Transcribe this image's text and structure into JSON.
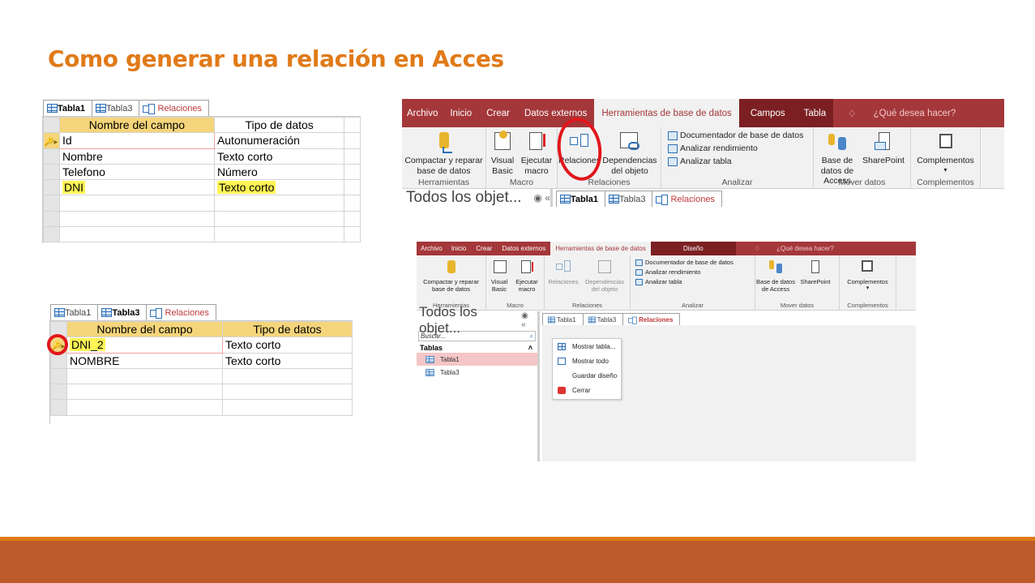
{
  "slide": {
    "title": "Como generar una relación en Acces",
    "accent_color": "#E07A18",
    "footer_color": "#BE5B2A"
  },
  "panel1": {
    "tabs": [
      {
        "label": "Tabla1",
        "icon": "table-icon",
        "active": true
      },
      {
        "label": "Tabla3",
        "icon": "table-icon",
        "active": false
      },
      {
        "label": "Relaciones",
        "icon": "relationships-icon",
        "active": false
      }
    ],
    "headers": [
      "Nombre del campo",
      "Tipo de datos"
    ],
    "rows": [
      {
        "field": "Id",
        "type": "Autonumeración",
        "key": true,
        "highlight": false
      },
      {
        "field": "Nombre",
        "type": "Texto corto",
        "key": false,
        "highlight": false
      },
      {
        "field": "Telefono",
        "type": "Número",
        "key": false,
        "highlight": false
      },
      {
        "field": "DNI",
        "type": "Texto corto",
        "key": false,
        "highlight": true
      }
    ]
  },
  "panel2": {
    "tabs": [
      {
        "label": "Tabla1",
        "icon": "table-icon",
        "active": false
      },
      {
        "label": "Tabla3",
        "icon": "table-icon",
        "active": true
      },
      {
        "label": "Relaciones",
        "icon": "relationships-icon",
        "active": false
      }
    ],
    "headers": [
      "Nombre del campo",
      "Tipo de datos"
    ],
    "rows": [
      {
        "field": "DNI_2",
        "type": "Texto corto",
        "key": true
      },
      {
        "field": "NOMBRE",
        "type": "Texto corto",
        "key": false
      }
    ]
  },
  "ribbon1": {
    "tabs": [
      "Archivo",
      "Inicio",
      "Crear",
      "Datos externos",
      "Herramientas de base de datos",
      "Campos",
      "Tabla"
    ],
    "tell_me": "¿Qué desea hacer?",
    "buttons": {
      "compact": "Compactar y reparar base de datos",
      "visual_basic": "Visual Basic",
      "run_macro": "Ejecutar macro",
      "relations": "Relaciones",
      "dependencies": "Dependencias del objeto",
      "documenter": "Documentador de base de datos",
      "analyze_perf": "Analizar rendimiento",
      "analyze_table": "Analizar tabla",
      "access_db": "Base de datos de Access",
      "sharepoint": "SharePoint",
      "addins": "Complementos"
    },
    "groups": [
      "Herramientas",
      "Macro",
      "Relaciones",
      "Analizar",
      "Mover datos",
      "Complementos"
    ],
    "nav_title": "Todos los objet...",
    "doc_tabs": [
      "Tabla1",
      "Tabla3",
      "Relaciones"
    ]
  },
  "ribbon2": {
    "tabs": [
      "Archivo",
      "Inicio",
      "Crear",
      "Datos externos",
      "Herramientas de base de datos",
      "Diseño"
    ],
    "tell_me": "¿Qué desea hacer?",
    "buttons": {
      "compact": "Compactar y reparar base de datos",
      "visual_basic": "Visual Basic",
      "run_macro": "Ejecutar macro",
      "relations": "Relaciones",
      "dependencies": "Dependencias del objeto",
      "documenter": "Documentador de base de datos",
      "analyze_perf": "Analizar rendimiento",
      "analyze_table": "Analizar tabla",
      "access_db": "Base de datos de Access",
      "sharepoint": "SharePoint",
      "addins": "Complementos"
    },
    "groups": [
      "Herramientas",
      "Macro",
      "Relaciones",
      "Analizar",
      "Mover datos",
      "Complementos"
    ],
    "nav": {
      "title": "Todos los objet...",
      "search_placeholder": "Buscar...",
      "section": "Tablas",
      "items": [
        "Tabla1",
        "Tabla3"
      ]
    },
    "doc_tabs": [
      "Tabla1",
      "Tabla3",
      "Relaciones"
    ],
    "context_menu": [
      "Mostrar tabla...",
      "Mostrar todo",
      "Guardar diseño",
      "Cerrar"
    ]
  }
}
